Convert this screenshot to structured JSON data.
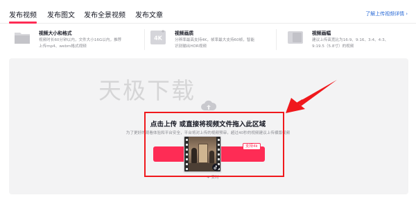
{
  "tabs": [
    {
      "label": "发布视频",
      "active": true
    },
    {
      "label": "发布图文",
      "active": false
    },
    {
      "label": "发布全景视频",
      "active": false
    },
    {
      "label": "发布文章",
      "active": false
    }
  ],
  "help_link": "了解上传视频详情",
  "info_cards": [
    {
      "icon": "folder-icon",
      "title": "视频大小和格式",
      "desc": [
        "视频时长60分钟以内，文件大小16G以内，推荐",
        "上传mp4、webm格式视频"
      ]
    },
    {
      "icon": "4k-quality-icon",
      "badge": "4K",
      "title": "视频画质",
      "desc": [
        "分辨率最高支持4K，帧率最大支持60帧，智能",
        "识别输出HDR视频"
      ]
    },
    {
      "icon": "aspect-ratio-icon",
      "title": "视频画幅",
      "desc": [
        "建议上传高宽比为16:9、9:16、3:4、4:3、",
        "9:19.5（5.8寸）的视频"
      ]
    }
  ],
  "upload": {
    "watermark": "天极下载",
    "title": "点击上传 或直接将视频文件拖入此区域",
    "note": "为了更好的观看体验和平台安全，平台将对上传的视频预审，超过40秒的视频建议上传横版视频",
    "button_label": "",
    "badge": "支持4k",
    "below_label": "安时"
  },
  "colors": {
    "accent": "#fe2c55",
    "annotation_red": "#f0181c",
    "link_blue": "#2a6ad6"
  }
}
